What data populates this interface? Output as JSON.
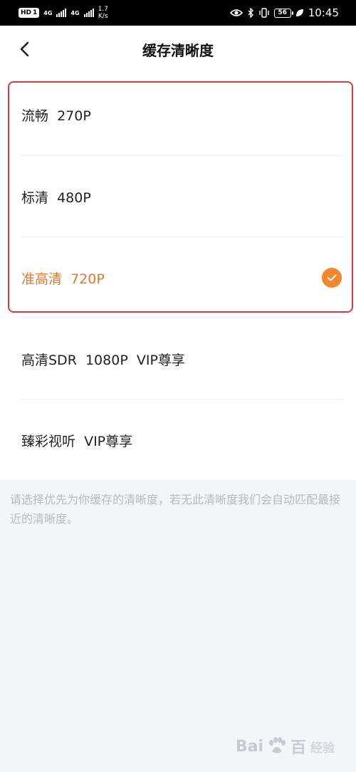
{
  "status_bar": {
    "hd": "HD",
    "sim": "1",
    "net1": "4G",
    "net2": "4G",
    "speed_value": "1.7",
    "speed_unit": "K/s",
    "battery": "56",
    "time": "10:45"
  },
  "nav": {
    "title": "缓存清晰度"
  },
  "options": [
    {
      "label": "流畅  270P",
      "selected": false
    },
    {
      "label": "标清  480P",
      "selected": false
    },
    {
      "label": "准高清  720P",
      "selected": true
    },
    {
      "label": "高清SDR  1080P  VIP尊享",
      "selected": false
    },
    {
      "label": "臻彩视听  VIP尊享",
      "selected": false
    }
  ],
  "tip": "请选择优先为你缓存的清晰度，若无此清晰度我们会自动匹配最接近的清晰度。",
  "watermark": {
    "brand": "Bai",
    "brand_end": "百",
    "sub": "经验"
  },
  "colors": {
    "accent": "#f5862a",
    "selected_text": "#e8762c",
    "highlight_border": "#d83a42"
  }
}
